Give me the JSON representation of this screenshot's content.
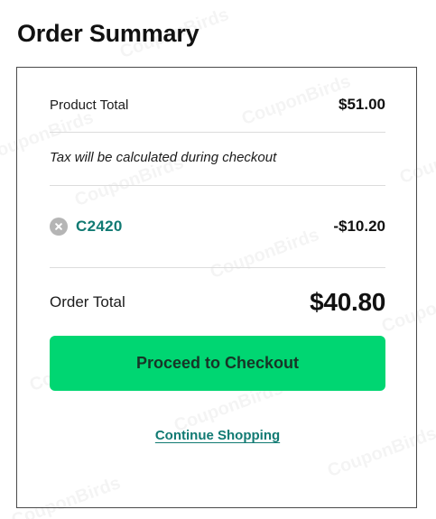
{
  "title": "Order Summary",
  "product": {
    "label": "Product Total",
    "value": "$51.00"
  },
  "tax_note": "Tax will be calculated during checkout",
  "coupon": {
    "code": "C2420",
    "discount": "-$10.20",
    "remove_icon": "close-circle-icon"
  },
  "total": {
    "label": "Order Total",
    "value": "$40.80"
  },
  "actions": {
    "checkout_label": "Proceed to Checkout",
    "continue_label": "Continue Shopping"
  },
  "watermark": "CouponBirds",
  "colors": {
    "accent_green": "#00d672",
    "link_teal": "#117a73",
    "border": "#4a4a4a"
  }
}
